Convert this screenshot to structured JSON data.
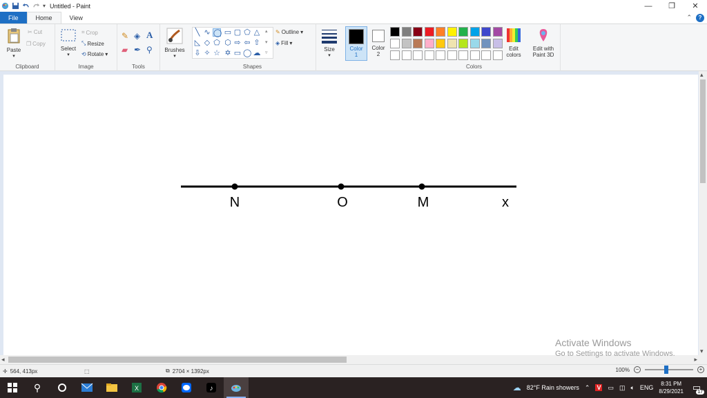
{
  "titlebar": {
    "title": "Untitled - Paint"
  },
  "tabs": [
    "File",
    "Home",
    "View"
  ],
  "ribbon": {
    "clipboard": {
      "label": "Clipboard",
      "paste": "Paste",
      "cut": "Cut",
      "copy": "Copy"
    },
    "image": {
      "label": "Image",
      "select": "Select",
      "crop": "Crop",
      "resize": "Resize",
      "rotate": "Rotate"
    },
    "tools": {
      "label": "Tools"
    },
    "brushes": {
      "label": "Brushes"
    },
    "shapes": {
      "label": "Shapes",
      "outline": "Outline",
      "fill": "Fill"
    },
    "size": {
      "label": "Size"
    },
    "color1": {
      "line1": "Color",
      "line2": "1"
    },
    "color2": {
      "line1": "Color",
      "line2": "2"
    },
    "colors": {
      "label": "Colors",
      "edit_line1": "Edit",
      "edit_line2": "colors",
      "palette_row1": [
        "#000000",
        "#7f7f7f",
        "#880015",
        "#ed1c24",
        "#ff7f27",
        "#fff200",
        "#22b14c",
        "#00a2e8",
        "#3f48cc",
        "#a349a4"
      ],
      "palette_row2": [
        "#ffffff",
        "#c3c3c3",
        "#b97a57",
        "#ffaec9",
        "#ffc90e",
        "#efe4b0",
        "#b5e61d",
        "#99d9ea",
        "#7092be",
        "#c8bfe7"
      ],
      "palette_row3": [
        "#ffffff",
        "#ffffff",
        "#ffffff",
        "#ffffff",
        "#ffffff",
        "#ffffff",
        "#ffffff",
        "#ffffff",
        "#ffffff",
        "#ffffff"
      ]
    },
    "paint3d": {
      "line1": "Edit with",
      "line2": "Paint 3D"
    }
  },
  "canvas": {
    "point_labels": {
      "n": "N",
      "o": "O",
      "m": "M",
      "x": "x"
    }
  },
  "status": {
    "cursor_pos": "564, 413px",
    "canvas_size": "2704 × 1392px",
    "zoom": "100%"
  },
  "watermark": {
    "line1": "Activate Windows",
    "line2": "Go to Settings to activate Windows."
  },
  "taskbar": {
    "weather": "82°F  Rain showers",
    "lang": "ENG",
    "time": "8:31 PM",
    "date": "8/29/2021",
    "notifications": "17"
  }
}
